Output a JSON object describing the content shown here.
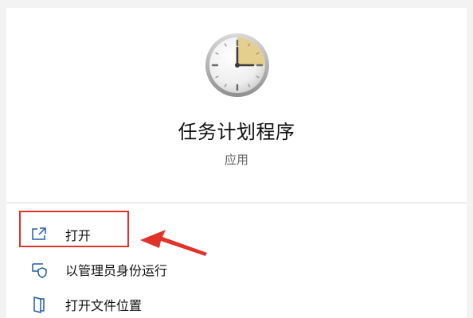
{
  "app": {
    "title": "任务计划程序",
    "subtitle": "应用",
    "icon": "task-scheduler-clock-icon"
  },
  "actions": [
    {
      "label": "打开",
      "icon": "open-window-icon"
    },
    {
      "label": "以管理员身份运行",
      "icon": "run-as-admin-shield-icon"
    },
    {
      "label": "打开文件位置",
      "icon": "file-location-icon"
    }
  ],
  "annotation": {
    "highlight_color": "#e0332a"
  }
}
